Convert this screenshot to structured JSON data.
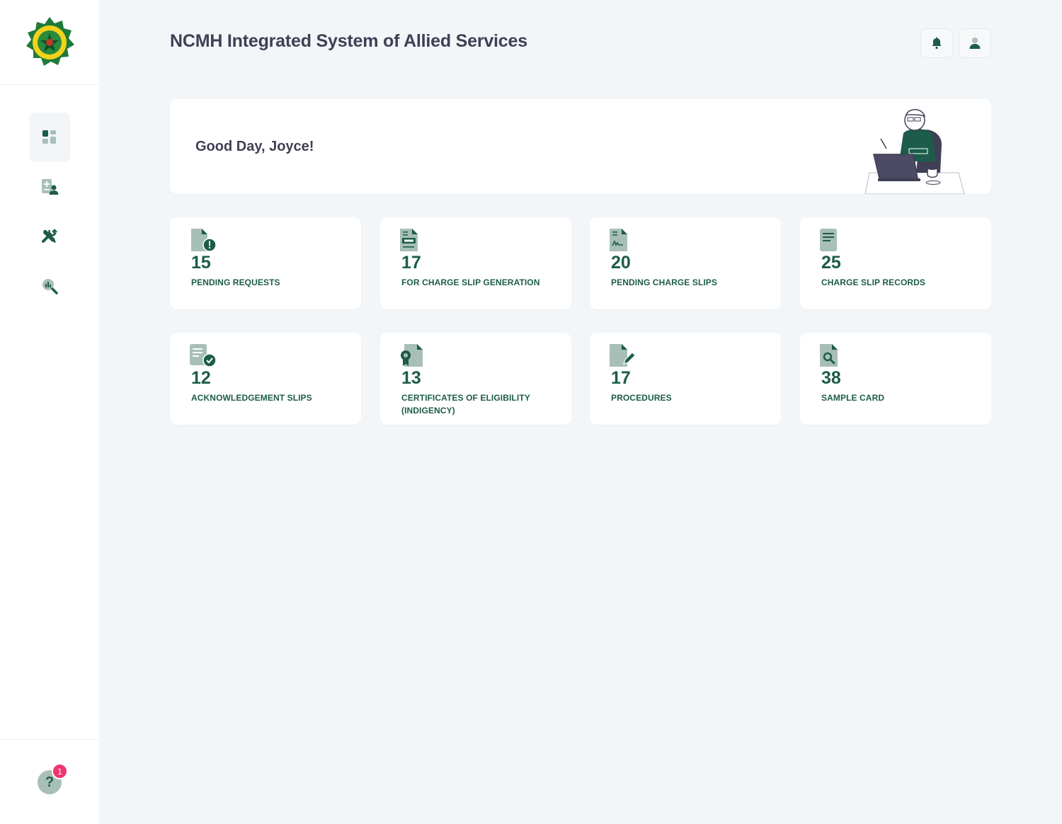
{
  "app": {
    "title": "NCMH Integrated System of Allied Services"
  },
  "sidebar": {
    "logo_icon": "ncmh-seal-logo",
    "items": [
      {
        "name": "dashboard",
        "icon": "dashboard-icon",
        "active": true
      },
      {
        "name": "patients",
        "icon": "patient-record-icon",
        "active": false
      },
      {
        "name": "maintenance",
        "icon": "tools-icon",
        "active": false
      },
      {
        "name": "reports",
        "icon": "analytics-search-icon",
        "active": false
      }
    ],
    "help": {
      "icon": "question-icon",
      "badge": "1"
    }
  },
  "header": {
    "notification_icon": "bell-icon",
    "profile_icon": "user-icon"
  },
  "greeting": {
    "text": "Good Day, Joyce!"
  },
  "stats": [
    {
      "value": "15",
      "label": "PENDING REQUESTS",
      "icon": "file-alert-icon"
    },
    {
      "value": "17",
      "label": "FOR CHARGE SLIP GENERATION",
      "icon": "file-card-icon"
    },
    {
      "value": "20",
      "label": "PENDING CHARGE SLIPS",
      "icon": "file-signature-icon"
    },
    {
      "value": "25",
      "label": "CHARGE SLIP RECORDS",
      "icon": "file-lines-icon"
    },
    {
      "value": "12",
      "label": "ACKNOWLEDGEMENT SLIPS",
      "icon": "file-check-icon"
    },
    {
      "value": "13",
      "label": "CERTIFICATES OF ELIGIBILITY (INDIGENCY)",
      "icon": "file-certificate-icon"
    },
    {
      "value": "17",
      "label": "PROCEDURES",
      "icon": "file-pen-icon"
    },
    {
      "value": "38",
      "label": "SAMPLE CARD",
      "icon": "file-search-icon"
    }
  ],
  "colors": {
    "primary": "#1d5c4a",
    "icon_light": "#a8bfb6",
    "background": "#f3f6f9",
    "badge": "#f0346d"
  }
}
